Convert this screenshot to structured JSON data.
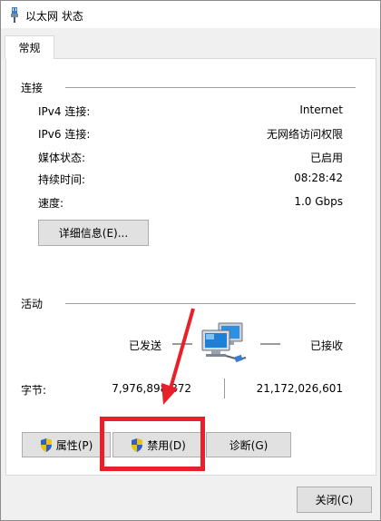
{
  "window": {
    "title": "以太网 状态",
    "icon": "ethernet-plug-icon"
  },
  "tabs": [
    {
      "label": "常规",
      "selected": true
    }
  ],
  "connection": {
    "section_title": "连接",
    "rows": [
      {
        "label": "IPv4 连接:",
        "value": "Internet"
      },
      {
        "label": "IPv6 连接:",
        "value": "无网络访问权限"
      },
      {
        "label": "媒体状态:",
        "value": "已启用"
      },
      {
        "label": "持续时间:",
        "value": "08:28:42"
      },
      {
        "label": "速度:",
        "value": "1.0 Gbps"
      }
    ],
    "details_button": "详细信息(E)..."
  },
  "activity": {
    "section_title": "活动",
    "sent_label": "已发送",
    "received_label": "已接收",
    "bytes_label": "字节:",
    "bytes_sent": "7,976,898,872",
    "bytes_received": "21,172,026,601",
    "network_icon": "network-computers-icon"
  },
  "buttons": {
    "properties": "属性(P)",
    "disable": "禁用(D)",
    "diagnose": "诊断(G)",
    "close": "关闭(C)"
  },
  "colors": {
    "highlight": "#e8202a",
    "button_bg": "#e1e1e1",
    "window_bg": "#f0f0f0"
  }
}
